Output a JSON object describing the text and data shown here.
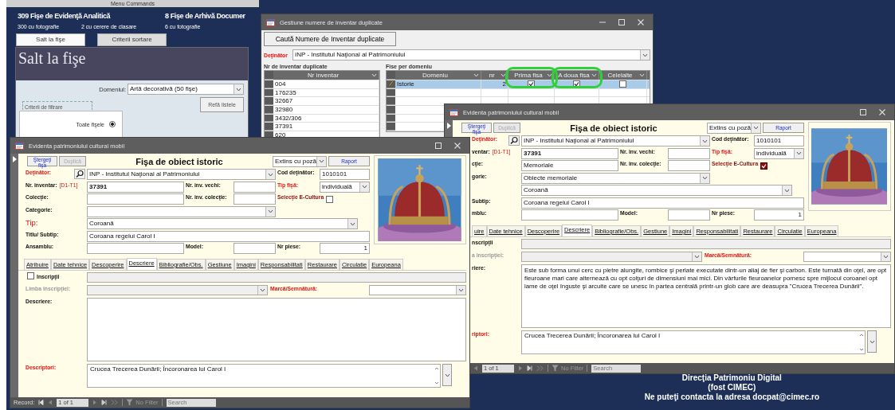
{
  "menu_bar": {
    "title": "Menu Commands"
  },
  "dashboard": {
    "stats": [
      {
        "title": "309 Fişe de Evidenţă Analitică",
        "details": [
          "300 cu fotografie",
          "2 cu cerere de clasare"
        ]
      },
      {
        "title": "8 Fişe de Arhivă Documer",
        "details": [
          "6 cu fotografie"
        ]
      }
    ],
    "tabs": [
      {
        "label": "Salt la fişe",
        "selected": true
      },
      {
        "label": "Criterii sortare",
        "selected": false
      }
    ],
    "panel": {
      "heading": "Salt la fişe",
      "domain_label": "Domeniul:",
      "domain_value": "Artă decorativă  (50 fişe)",
      "refresh_button": "Refă listele",
      "filter_group": "Criterii de filtrare",
      "filters": [
        {
          "label": "Toate fişele",
          "selected": true
        }
      ]
    },
    "footer": [
      "Direcţia Patrimoniu Digital",
      "(fost CIMEC)",
      "Ne puteţi contacta la adresa docpat@cimec.ro"
    ]
  },
  "duplicates_window": {
    "title": "Gestiune numere de inventar duplicate",
    "search_button": "Caută Numere de Inventar duplicate",
    "holder": {
      "label": "Deţinător",
      "value": "INP - Institutul Naţional al Patrimoniului"
    },
    "inventory_list": {
      "caption": "Nr de inventar duplicate",
      "column": "Nr inventar",
      "rows": [
        "004",
        "176235",
        "32667",
        "32980",
        "3432/306",
        "37391",
        "620"
      ]
    },
    "domains": {
      "caption": "Fise per domeniu",
      "columns": [
        {
          "label": "Domeniu",
          "highlighted": false
        },
        {
          "label": "nr",
          "highlighted": false
        },
        {
          "label": "Prima fisa",
          "highlighted": true
        },
        {
          "label": "A doua fisa",
          "highlighted": true
        },
        {
          "label": "Celelalte",
          "highlighted": false
        }
      ],
      "rows": [
        {
          "domain": "Istorie",
          "count": "2",
          "first": true,
          "second": true,
          "others": false,
          "selected": true
        }
      ]
    }
  },
  "record_windows": [
    {
      "title": "Evidenta patrimoniului cultural mobil",
      "labels_cut": true,
      "toolbar": {
        "delete_button": "Ştergeţi fişa",
        "duplicate_button": "Duplică",
        "duplicate_disabled": true,
        "form_title": "Fişa de obiect istoric",
        "view_select": "Extins cu poză",
        "report_button": "Raport"
      },
      "holder": {
        "label": "Deţinător:",
        "required": true,
        "value": "INP - Institutul Naţional al Patrimoniului"
      },
      "holder_code": {
        "label": "Cod deţinător:",
        "value": "1010101"
      },
      "inventory": {
        "label": "ventar:",
        "code": "[D1-T1]",
        "value": "37391"
      },
      "old_inventory": {
        "label": "Nr. inv. vechi:"
      },
      "sheet_type": {
        "label": "Tip fişă:",
        "required": true,
        "value": "individuală"
      },
      "collection": {
        "label": "cţie:",
        "value": "Memoriale"
      },
      "collection_inventory": {
        "label": "Nr. inv. colecţie:"
      },
      "ecultura": {
        "label": "Selecţie E-Cultura",
        "checked": true
      },
      "category": {
        "label": "gorie:",
        "value": "Obiecte memoriale"
      },
      "type": {
        "value": "Coroană"
      },
      "title_field": {
        "label": "Subtip:",
        "value": "Coroana regelui Carol I"
      },
      "ensemble": {
        "label": "mblu:"
      },
      "model": {
        "label": "Model:"
      },
      "pieces": {
        "label": "Nr piese:",
        "value": "1"
      },
      "tabs": [
        {
          "label": "uire",
          "selected": false
        },
        {
          "label": "Date tehnice",
          "selected": false
        },
        {
          "label": "Descoperire",
          "selected": false
        },
        {
          "label": "Descriere",
          "selected": true
        },
        {
          "label": "Bibliografie/Obs.",
          "selected": false
        },
        {
          "label": "Gestiune",
          "selected": false
        },
        {
          "label": "Imagini",
          "selected": false
        },
        {
          "label": "Responsabilitati",
          "selected": false
        },
        {
          "label": "Restaurare",
          "selected": false
        },
        {
          "label": "Circulatie",
          "selected": false
        },
        {
          "label": "Europeana",
          "selected": false
        }
      ],
      "inscriptions": {
        "label": "nscripţii"
      },
      "inscription_language": {
        "label": "a inscripţiei:",
        "disabled": true
      },
      "mark": {
        "label": "Marcă/Semnătură:",
        "required": true
      },
      "description": {
        "label": "riere:",
        "value": "Este sub forma unui cerc cu pietre alungite, rombice şi perlate executate dintr-un aliaj de fier şi carbon. Este turnată din oţel, are opt fleuroane mari care alternează cu opt colţuri de dimensiuni mai mici. Din vârfurile fleuroanelor pornesc spre mijlocul coroanei opt lame de oţel înguste şi arcuite care se unesc în partea centrală printr-un glob care are deasupra \"Crucea Trecerea Dunării\"."
      },
      "descriptors": {
        "label": "riptori:",
        "required": true,
        "value": "Crucea Trecerea Dunării; Încoronarea lui Carol I"
      },
      "navigator": {
        "position": "1 of 1",
        "filter": "No Filter",
        "search": "Search"
      }
    },
    {
      "title": "Evidenta patrimoniului cultural mobil",
      "labels_cut": false,
      "toolbar": {
        "delete_button": "Ştergeţi fişa",
        "duplicate_button": "Duplică",
        "duplicate_disabled": true,
        "form_title": "Fişa de obiect istoric",
        "view_select": "Extins cu poză",
        "report_button": "Raport"
      },
      "holder": {
        "label": "Deţinător:",
        "required": true,
        "value": "INP - Institutul Naţional al Patrimoniului"
      },
      "holder_code": {
        "label": "Cod deţinător:",
        "value": "1010101"
      },
      "inventory": {
        "label": "Nr. inventar:",
        "code": "[D1-T1]",
        "value": "37391"
      },
      "old_inventory": {
        "label": "Nr. inv. vechi:"
      },
      "sheet_type": {
        "label": "Tip fişă:",
        "required": true,
        "value": "individuală"
      },
      "collection": {
        "label": "Colecţie:"
      },
      "collection_inventory": {
        "label": "Nr. inv. colecţie:"
      },
      "ecultura": {
        "label": "Selecţie E-Cultura",
        "checked": false
      },
      "category": {
        "label": "Categorie:"
      },
      "type": {
        "label": "Tip:",
        "required": true,
        "value": "Coroană"
      },
      "title_field": {
        "label": "Titlu/ Subtip:",
        "value": "Coroana regelui Carol I"
      },
      "ensemble": {
        "label": "Ansamblu:"
      },
      "model": {
        "label": "Model:"
      },
      "pieces": {
        "label": "Nr piese:",
        "value": "1"
      },
      "tabs": [
        {
          "label": "Atribuire",
          "selected": false
        },
        {
          "label": "Date tehnice",
          "selected": false
        },
        {
          "label": "Descoperire",
          "selected": false
        },
        {
          "label": "Descriere",
          "selected": true
        },
        {
          "label": "Bibliografie/Obs.",
          "selected": false
        },
        {
          "label": "Gestiune",
          "selected": false
        },
        {
          "label": "Imagini",
          "selected": false
        },
        {
          "label": "Responsabilitati",
          "selected": false
        },
        {
          "label": "Restaurare",
          "selected": false
        },
        {
          "label": "Circulatie",
          "selected": false
        },
        {
          "label": "Europeana",
          "selected": false
        }
      ],
      "inscriptions": {
        "label": "Inscripţii",
        "checked": false
      },
      "inscription_language": {
        "label": "Limba inscripţiei:",
        "disabled": true
      },
      "mark": {
        "label": "Marcă/Semnătură:",
        "required": true
      },
      "description": {
        "label": "Descriere:"
      },
      "descriptors": {
        "label": "Descriptori:",
        "required": true,
        "value": "Crucea Trecerea Dunării; Încoronarea lui Carol I"
      },
      "navigator": {
        "label": "Record:",
        "position": "1 of 1",
        "filter": "No Filter",
        "search": "Search"
      }
    }
  ]
}
